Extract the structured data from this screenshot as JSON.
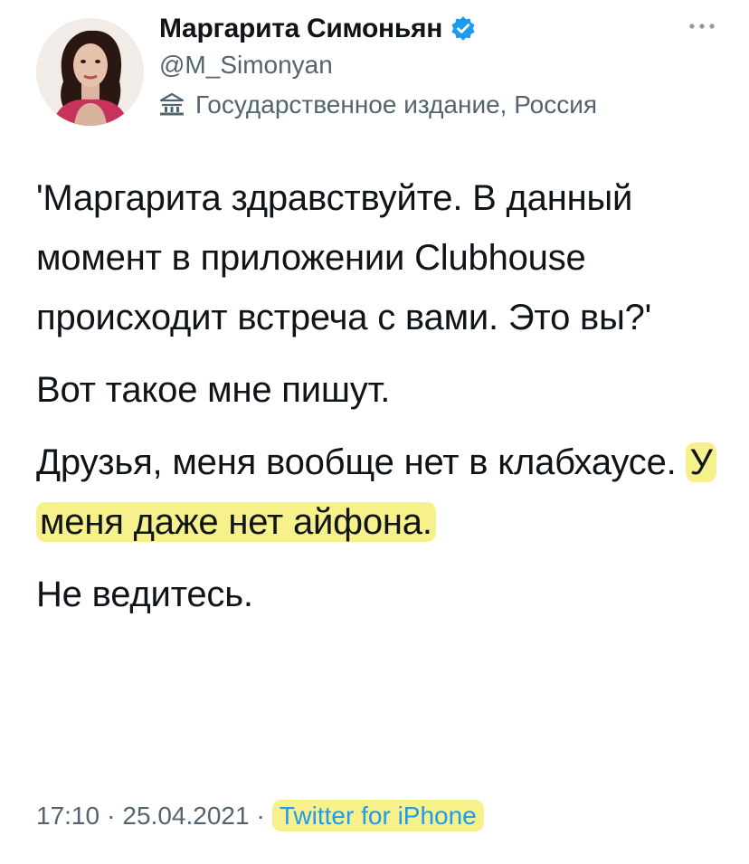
{
  "author": {
    "display_name": "Маргарита Симоньян",
    "handle": "@M_Simonyan",
    "label": "Государственное издание, Россия",
    "verified": true,
    "avatar_icon": "avatar-portrait",
    "label_icon": "government-building-icon"
  },
  "tweet": {
    "paragraphs": [
      {
        "text": "'Маргарита здравствуйте. В данный момент в приложении Clubhouse происходит встреча с вами. Это вы?'"
      },
      {
        "text": "Вот такое мне пишут."
      },
      {
        "text": "Друзья, меня вообще нет в клабхаусе. ",
        "highlight": "У меня даже нет айфона."
      },
      {
        "text": "Не ведитесь."
      }
    ],
    "time": "17:10",
    "date": "25.04.2021",
    "separator": "·",
    "source": "Twitter for iPhone"
  },
  "colors": {
    "text": "#0f1419",
    "secondary": "#536471",
    "accent": "#1d9bf0",
    "highlight": "#f6f18a"
  }
}
